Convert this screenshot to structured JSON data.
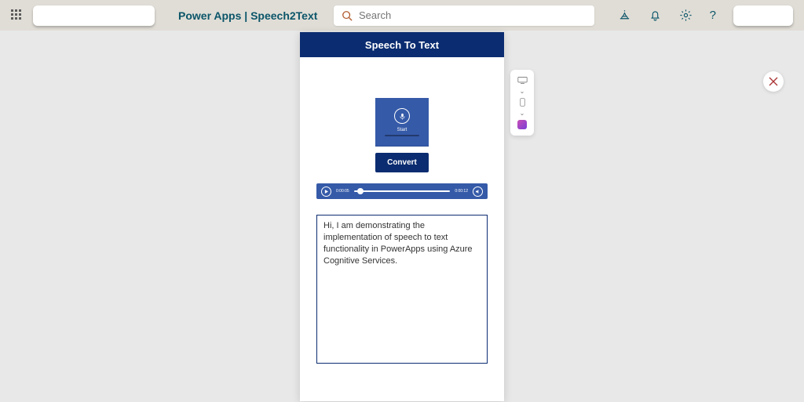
{
  "header": {
    "brand": "Power Apps  |  Speech2Text",
    "search_placeholder": "Search"
  },
  "app": {
    "title": "Speech To Text",
    "mic_label": "Start",
    "convert_label": "Convert",
    "player": {
      "current": "0:00:05",
      "total": "0:00:12"
    },
    "transcript": "Hi, I am demonstrating the implementation of speech to text functionality in PowerApps using Azure Cognitive Services."
  },
  "colors": {
    "navy": "#0b2c70",
    "blue": "#355aa8",
    "teal": "#0b5569"
  }
}
